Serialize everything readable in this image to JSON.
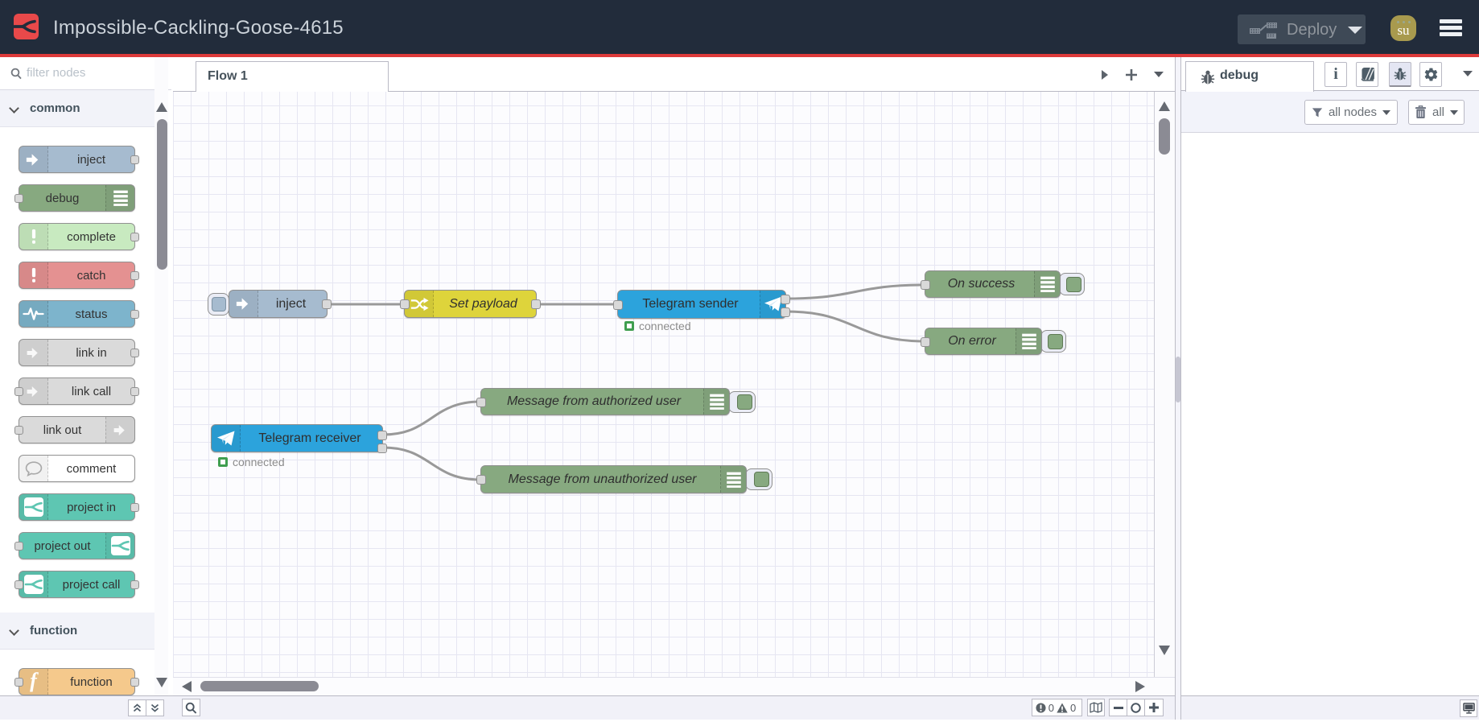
{
  "header": {
    "title": "Impossible-Cackling-Goose-4615",
    "deploy_label": "Deploy",
    "avatar_initials": "su"
  },
  "palette": {
    "search_placeholder": "filter nodes",
    "sections": [
      {
        "label": "common",
        "items": [
          {
            "label": "inject"
          },
          {
            "label": "debug"
          },
          {
            "label": "complete"
          },
          {
            "label": "catch"
          },
          {
            "label": "status"
          },
          {
            "label": "link in"
          },
          {
            "label": "link call"
          },
          {
            "label": "link out"
          },
          {
            "label": "comment"
          },
          {
            "label": "project in"
          },
          {
            "label": "project out"
          },
          {
            "label": "project call"
          }
        ]
      },
      {
        "label": "function",
        "items": [
          {
            "label": "function"
          }
        ]
      }
    ]
  },
  "workspace": {
    "tabs": [
      {
        "label": "Flow 1"
      }
    ],
    "nodes": [
      {
        "label": "inject"
      },
      {
        "label": "Set payload"
      },
      {
        "label": "Telegram sender",
        "status": "connected"
      },
      {
        "label": "On success"
      },
      {
        "label": "On error"
      },
      {
        "label": "Telegram receiver",
        "status": "connected"
      },
      {
        "label": "Message from authorized user"
      },
      {
        "label": "Message from unauthorized user"
      }
    ]
  },
  "sidebar": {
    "active_tab_label": "debug",
    "filter_button_label": "all nodes",
    "clear_button_label": "all"
  },
  "footer": {
    "error_count": "0",
    "warning_count": "0"
  },
  "colors": {
    "accent_red": "#dd3a3a",
    "header_bg": "#222c3b",
    "logo_red": "#e8494a",
    "node_inject": "#a6bbcf",
    "node_debug": "#87a980",
    "node_complete": "#c8eac0",
    "node_catch": "#e49191",
    "node_status": "#7db4cc",
    "node_link": "#dadada",
    "node_comment": "#ffffff",
    "node_project": "#5ec6b2",
    "node_function": "#f5c98c",
    "node_change": "#ded43b",
    "node_telegram": "#2ca3dc",
    "wire": "#999999",
    "status_green": "#3f9e4f"
  }
}
